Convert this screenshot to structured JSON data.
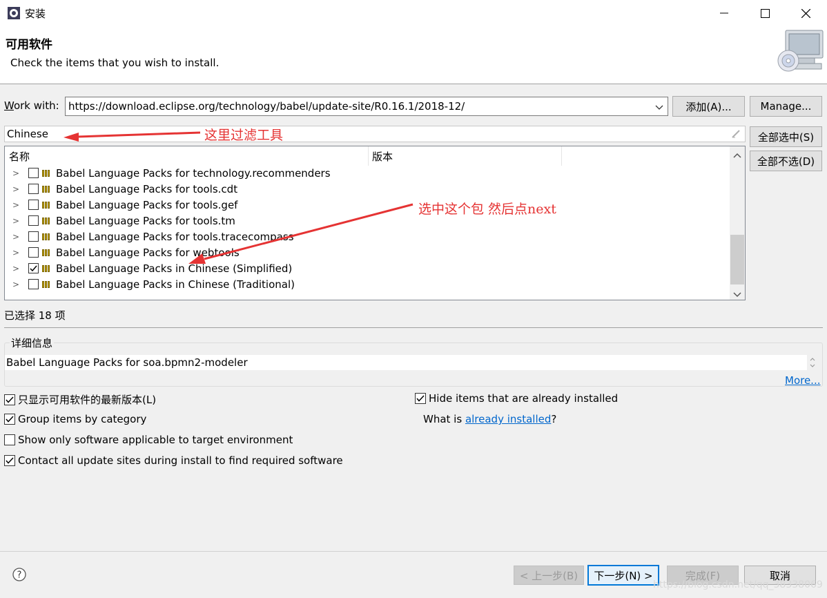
{
  "window": {
    "title": "安装",
    "controls": {
      "minimize": "—",
      "maximize": "☐",
      "close": "✕"
    }
  },
  "header": {
    "title": "可用软件",
    "description": "Check the items that you wish to install."
  },
  "work_with": {
    "label_prefix": "W",
    "label_rest": "ork with:",
    "value": "https://download.eclipse.org/technology/babel/update-site/R0.16.1/2018-12/",
    "add_button": "添加(A)...",
    "manage_button": "Manage..."
  },
  "filter": {
    "value": "Chinese"
  },
  "side_buttons": {
    "select_all": "全部选中(S)",
    "deselect_all": "全部不选(D)"
  },
  "tree": {
    "columns": [
      "名称",
      "版本"
    ],
    "rows": [
      {
        "label": "Babel Language Packs for technology.recommenders",
        "checked": false
      },
      {
        "label": "Babel Language Packs for tools.cdt",
        "checked": false
      },
      {
        "label": "Babel Language Packs for tools.gef",
        "checked": false
      },
      {
        "label": "Babel Language Packs for tools.tm",
        "checked": false
      },
      {
        "label": "Babel Language Packs for tools.tracecompass",
        "checked": false
      },
      {
        "label": "Babel Language Packs for webtools",
        "checked": false
      },
      {
        "label": "Babel Language Packs in Chinese (Simplified)",
        "checked": true
      },
      {
        "label": "Babel Language Packs in Chinese (Traditional)",
        "checked": false
      }
    ]
  },
  "selection_count": "已选择 18 项",
  "details": {
    "label": "详细信息",
    "value": "Babel Language Packs for soa.bpmn2-modeler",
    "more_link": "More..."
  },
  "options": {
    "latest_only": "只显示可用软件的最新版本(L)",
    "group_by_category": "Group items by category",
    "show_applicable": "Show only software applicable to target environment",
    "contact_sites": "Contact all update sites during install to find required software",
    "hide_installed": "Hide items that are already installed",
    "what_is_prefix": "What is ",
    "already_installed_link": "already installed",
    "what_is_suffix": "?"
  },
  "footer": {
    "back": "< 上一步(B)",
    "next": "下一步(N) >",
    "finish": "完成(F)",
    "cancel": "取消"
  },
  "annotations": {
    "filter_note": "这里过滤工具",
    "select_note": "选中这个包  然后点next"
  },
  "watermark": "https://blog.csdn.net/qq_38338069",
  "colors": {
    "annotation": "#e53333",
    "link": "#0066cc",
    "primary_border": "#0078d7"
  },
  "icons": {
    "app": "eclipse-gear-icon",
    "header": "computer-cd-icon",
    "help": "help-icon"
  }
}
